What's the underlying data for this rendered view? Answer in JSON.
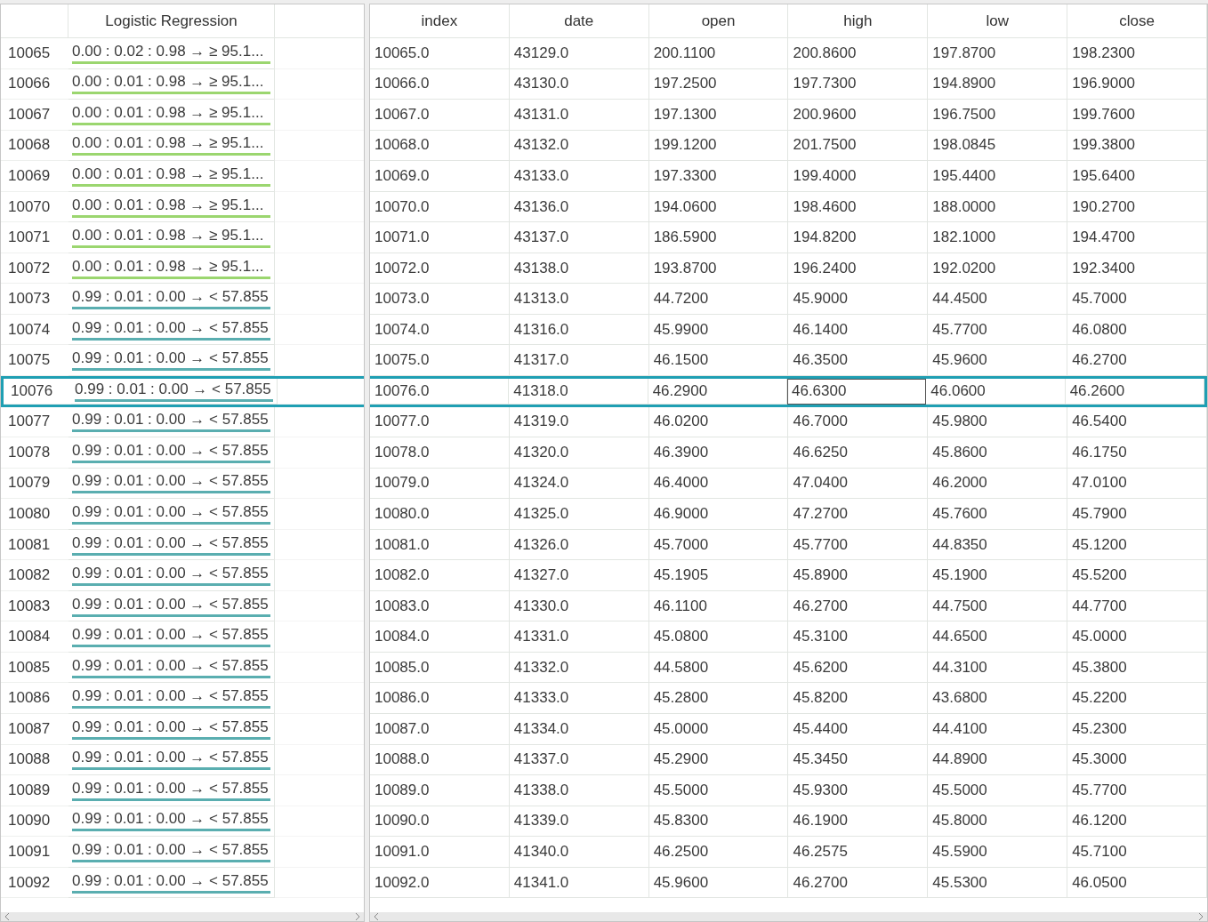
{
  "prediction_column": "Logistic Regression",
  "columns": [
    "index",
    "date",
    "open",
    "high",
    "low",
    "close"
  ],
  "rows": [
    {
      "id": "10065",
      "prediction": "0.00 : 0.02 : 0.98 → ≥ 95.1...",
      "color": "#9bd66f",
      "selected": false,
      "cells": [
        {
          "v": "10065.0",
          "focused": false
        },
        {
          "v": "43129.0",
          "focused": false
        },
        {
          "v": "200.1100",
          "focused": false
        },
        {
          "v": "200.8600",
          "focused": false
        },
        {
          "v": "197.8700",
          "focused": false
        },
        {
          "v": "198.2300",
          "focused": false
        }
      ]
    },
    {
      "id": "10066",
      "prediction": "0.00 : 0.01 : 0.98 → ≥ 95.1...",
      "color": "#9bd66f",
      "selected": false,
      "cells": [
        {
          "v": "10066.0",
          "focused": false
        },
        {
          "v": "43130.0",
          "focused": false
        },
        {
          "v": "197.2500",
          "focused": false
        },
        {
          "v": "197.7300",
          "focused": false
        },
        {
          "v": "194.8900",
          "focused": false
        },
        {
          "v": "196.9000",
          "focused": false
        }
      ]
    },
    {
      "id": "10067",
      "prediction": "0.00 : 0.01 : 0.98 → ≥ 95.1...",
      "color": "#9bd66f",
      "selected": false,
      "cells": [
        {
          "v": "10067.0",
          "focused": false
        },
        {
          "v": "43131.0",
          "focused": false
        },
        {
          "v": "197.1300",
          "focused": false
        },
        {
          "v": "200.9600",
          "focused": false
        },
        {
          "v": "196.7500",
          "focused": false
        },
        {
          "v": "199.7600",
          "focused": false
        }
      ]
    },
    {
      "id": "10068",
      "prediction": "0.00 : 0.01 : 0.98 → ≥ 95.1...",
      "color": "#9bd66f",
      "selected": false,
      "cells": [
        {
          "v": "10068.0",
          "focused": false
        },
        {
          "v": "43132.0",
          "focused": false
        },
        {
          "v": "199.1200",
          "focused": false
        },
        {
          "v": "201.7500",
          "focused": false
        },
        {
          "v": "198.0845",
          "focused": false
        },
        {
          "v": "199.3800",
          "focused": false
        }
      ]
    },
    {
      "id": "10069",
      "prediction": "0.00 : 0.01 : 0.98 → ≥ 95.1...",
      "color": "#9bd66f",
      "selected": false,
      "cells": [
        {
          "v": "10069.0",
          "focused": false
        },
        {
          "v": "43133.0",
          "focused": false
        },
        {
          "v": "197.3300",
          "focused": false
        },
        {
          "v": "199.4000",
          "focused": false
        },
        {
          "v": "195.4400",
          "focused": false
        },
        {
          "v": "195.6400",
          "focused": false
        }
      ]
    },
    {
      "id": "10070",
      "prediction": "0.00 : 0.01 : 0.98 → ≥ 95.1...",
      "color": "#9bd66f",
      "selected": false,
      "cells": [
        {
          "v": "10070.0",
          "focused": false
        },
        {
          "v": "43136.0",
          "focused": false
        },
        {
          "v": "194.0600",
          "focused": false
        },
        {
          "v": "198.4600",
          "focused": false
        },
        {
          "v": "188.0000",
          "focused": false
        },
        {
          "v": "190.2700",
          "focused": false
        }
      ]
    },
    {
      "id": "10071",
      "prediction": "0.00 : 0.01 : 0.98 → ≥ 95.1...",
      "color": "#9bd66f",
      "selected": false,
      "cells": [
        {
          "v": "10071.0",
          "focused": false
        },
        {
          "v": "43137.0",
          "focused": false
        },
        {
          "v": "186.5900",
          "focused": false
        },
        {
          "v": "194.8200",
          "focused": false
        },
        {
          "v": "182.1000",
          "focused": false
        },
        {
          "v": "194.4700",
          "focused": false
        }
      ]
    },
    {
      "id": "10072",
      "prediction": "0.00 : 0.01 : 0.98 → ≥ 95.1...",
      "color": "#9bd66f",
      "selected": false,
      "cells": [
        {
          "v": "10072.0",
          "focused": false
        },
        {
          "v": "43138.0",
          "focused": false
        },
        {
          "v": "193.8700",
          "focused": false
        },
        {
          "v": "196.2400",
          "focused": false
        },
        {
          "v": "192.0200",
          "focused": false
        },
        {
          "v": "192.3400",
          "focused": false
        }
      ]
    },
    {
      "id": "10073",
      "prediction": "0.99 : 0.01 : 0.00 → < 57.855",
      "color": "#5aaeb0",
      "selected": false,
      "cells": [
        {
          "v": "10073.0",
          "focused": false
        },
        {
          "v": "41313.0",
          "focused": false
        },
        {
          "v": "44.7200",
          "focused": false
        },
        {
          "v": "45.9000",
          "focused": false
        },
        {
          "v": "44.4500",
          "focused": false
        },
        {
          "v": "45.7000",
          "focused": false
        }
      ]
    },
    {
      "id": "10074",
      "prediction": "0.99 : 0.01 : 0.00 → < 57.855",
      "color": "#5aaeb0",
      "selected": false,
      "cells": [
        {
          "v": "10074.0",
          "focused": false
        },
        {
          "v": "41316.0",
          "focused": false
        },
        {
          "v": "45.9900",
          "focused": false
        },
        {
          "v": "46.1400",
          "focused": false
        },
        {
          "v": "45.7700",
          "focused": false
        },
        {
          "v": "46.0800",
          "focused": false
        }
      ]
    },
    {
      "id": "10075",
      "prediction": "0.99 : 0.01 : 0.00 → < 57.855",
      "color": "#5aaeb0",
      "selected": false,
      "cells": [
        {
          "v": "10075.0",
          "focused": false
        },
        {
          "v": "41317.0",
          "focused": false
        },
        {
          "v": "46.1500",
          "focused": false
        },
        {
          "v": "46.3500",
          "focused": false
        },
        {
          "v": "45.9600",
          "focused": false
        },
        {
          "v": "46.2700",
          "focused": false
        }
      ]
    },
    {
      "id": "10076",
      "prediction": "0.99 : 0.01 : 0.00 → < 57.855",
      "color": "#5aaeb0",
      "selected": true,
      "cells": [
        {
          "v": "10076.0",
          "focused": false
        },
        {
          "v": "41318.0",
          "focused": false
        },
        {
          "v": "46.2900",
          "focused": false
        },
        {
          "v": "46.6300",
          "focused": true
        },
        {
          "v": "46.0600",
          "focused": false
        },
        {
          "v": "46.2600",
          "focused": false
        }
      ]
    },
    {
      "id": "10077",
      "prediction": "0.99 : 0.01 : 0.00 → < 57.855",
      "color": "#5aaeb0",
      "selected": false,
      "cells": [
        {
          "v": "10077.0",
          "focused": false
        },
        {
          "v": "41319.0",
          "focused": false
        },
        {
          "v": "46.0200",
          "focused": false
        },
        {
          "v": "46.7000",
          "focused": false
        },
        {
          "v": "45.9800",
          "focused": false
        },
        {
          "v": "46.5400",
          "focused": false
        }
      ]
    },
    {
      "id": "10078",
      "prediction": "0.99 : 0.01 : 0.00 → < 57.855",
      "color": "#5aaeb0",
      "selected": false,
      "cells": [
        {
          "v": "10078.0",
          "focused": false
        },
        {
          "v": "41320.0",
          "focused": false
        },
        {
          "v": "46.3900",
          "focused": false
        },
        {
          "v": "46.6250",
          "focused": false
        },
        {
          "v": "45.8600",
          "focused": false
        },
        {
          "v": "46.1750",
          "focused": false
        }
      ]
    },
    {
      "id": "10079",
      "prediction": "0.99 : 0.01 : 0.00 → < 57.855",
      "color": "#5aaeb0",
      "selected": false,
      "cells": [
        {
          "v": "10079.0",
          "focused": false
        },
        {
          "v": "41324.0",
          "focused": false
        },
        {
          "v": "46.4000",
          "focused": false
        },
        {
          "v": "47.0400",
          "focused": false
        },
        {
          "v": "46.2000",
          "focused": false
        },
        {
          "v": "47.0100",
          "focused": false
        }
      ]
    },
    {
      "id": "10080",
      "prediction": "0.99 : 0.01 : 0.00 → < 57.855",
      "color": "#5aaeb0",
      "selected": false,
      "cells": [
        {
          "v": "10080.0",
          "focused": false
        },
        {
          "v": "41325.0",
          "focused": false
        },
        {
          "v": "46.9000",
          "focused": false
        },
        {
          "v": "47.2700",
          "focused": false
        },
        {
          "v": "45.7600",
          "focused": false
        },
        {
          "v": "45.7900",
          "focused": false
        }
      ]
    },
    {
      "id": "10081",
      "prediction": "0.99 : 0.01 : 0.00 → < 57.855",
      "color": "#5aaeb0",
      "selected": false,
      "cells": [
        {
          "v": "10081.0",
          "focused": false
        },
        {
          "v": "41326.0",
          "focused": false
        },
        {
          "v": "45.7000",
          "focused": false
        },
        {
          "v": "45.7700",
          "focused": false
        },
        {
          "v": "44.8350",
          "focused": false
        },
        {
          "v": "45.1200",
          "focused": false
        }
      ]
    },
    {
      "id": "10082",
      "prediction": "0.99 : 0.01 : 0.00 → < 57.855",
      "color": "#5aaeb0",
      "selected": false,
      "cells": [
        {
          "v": "10082.0",
          "focused": false
        },
        {
          "v": "41327.0",
          "focused": false
        },
        {
          "v": "45.1905",
          "focused": false
        },
        {
          "v": "45.8900",
          "focused": false
        },
        {
          "v": "45.1900",
          "focused": false
        },
        {
          "v": "45.5200",
          "focused": false
        }
      ]
    },
    {
      "id": "10083",
      "prediction": "0.99 : 0.01 : 0.00 → < 57.855",
      "color": "#5aaeb0",
      "selected": false,
      "cells": [
        {
          "v": "10083.0",
          "focused": false
        },
        {
          "v": "41330.0",
          "focused": false
        },
        {
          "v": "46.1100",
          "focused": false
        },
        {
          "v": "46.2700",
          "focused": false
        },
        {
          "v": "44.7500",
          "focused": false
        },
        {
          "v": "44.7700",
          "focused": false
        }
      ]
    },
    {
      "id": "10084",
      "prediction": "0.99 : 0.01 : 0.00 → < 57.855",
      "color": "#5aaeb0",
      "selected": false,
      "cells": [
        {
          "v": "10084.0",
          "focused": false
        },
        {
          "v": "41331.0",
          "focused": false
        },
        {
          "v": "45.0800",
          "focused": false
        },
        {
          "v": "45.3100",
          "focused": false
        },
        {
          "v": "44.6500",
          "focused": false
        },
        {
          "v": "45.0000",
          "focused": false
        }
      ]
    },
    {
      "id": "10085",
      "prediction": "0.99 : 0.01 : 0.00 → < 57.855",
      "color": "#5aaeb0",
      "selected": false,
      "cells": [
        {
          "v": "10085.0",
          "focused": false
        },
        {
          "v": "41332.0",
          "focused": false
        },
        {
          "v": "44.5800",
          "focused": false
        },
        {
          "v": "45.6200",
          "focused": false
        },
        {
          "v": "44.3100",
          "focused": false
        },
        {
          "v": "45.3800",
          "focused": false
        }
      ]
    },
    {
      "id": "10086",
      "prediction": "0.99 : 0.01 : 0.00 → < 57.855",
      "color": "#5aaeb0",
      "selected": false,
      "cells": [
        {
          "v": "10086.0",
          "focused": false
        },
        {
          "v": "41333.0",
          "focused": false
        },
        {
          "v": "45.2800",
          "focused": false
        },
        {
          "v": "45.8200",
          "focused": false
        },
        {
          "v": "43.6800",
          "focused": false
        },
        {
          "v": "45.2200",
          "focused": false
        }
      ]
    },
    {
      "id": "10087",
      "prediction": "0.99 : 0.01 : 0.00 → < 57.855",
      "color": "#5aaeb0",
      "selected": false,
      "cells": [
        {
          "v": "10087.0",
          "focused": false
        },
        {
          "v": "41334.0",
          "focused": false
        },
        {
          "v": "45.0000",
          "focused": false
        },
        {
          "v": "45.4400",
          "focused": false
        },
        {
          "v": "44.4100",
          "focused": false
        },
        {
          "v": "45.2300",
          "focused": false
        }
      ]
    },
    {
      "id": "10088",
      "prediction": "0.99 : 0.01 : 0.00 → < 57.855",
      "color": "#5aaeb0",
      "selected": false,
      "cells": [
        {
          "v": "10088.0",
          "focused": false
        },
        {
          "v": "41337.0",
          "focused": false
        },
        {
          "v": "45.2900",
          "focused": false
        },
        {
          "v": "45.3450",
          "focused": false
        },
        {
          "v": "44.8900",
          "focused": false
        },
        {
          "v": "45.3000",
          "focused": false
        }
      ]
    },
    {
      "id": "10089",
      "prediction": "0.99 : 0.01 : 0.00 → < 57.855",
      "color": "#5aaeb0",
      "selected": false,
      "cells": [
        {
          "v": "10089.0",
          "focused": false
        },
        {
          "v": "41338.0",
          "focused": false
        },
        {
          "v": "45.5000",
          "focused": false
        },
        {
          "v": "45.9300",
          "focused": false
        },
        {
          "v": "45.5000",
          "focused": false
        },
        {
          "v": "45.7700",
          "focused": false
        }
      ]
    },
    {
      "id": "10090",
      "prediction": "0.99 : 0.01 : 0.00 → < 57.855",
      "color": "#5aaeb0",
      "selected": false,
      "cells": [
        {
          "v": "10090.0",
          "focused": false
        },
        {
          "v": "41339.0",
          "focused": false
        },
        {
          "v": "45.8300",
          "focused": false
        },
        {
          "v": "46.1900",
          "focused": false
        },
        {
          "v": "45.8000",
          "focused": false
        },
        {
          "v": "46.1200",
          "focused": false
        }
      ]
    },
    {
      "id": "10091",
      "prediction": "0.99 : 0.01 : 0.00 → < 57.855",
      "color": "#5aaeb0",
      "selected": false,
      "cells": [
        {
          "v": "10091.0",
          "focused": false
        },
        {
          "v": "41340.0",
          "focused": false
        },
        {
          "v": "46.2500",
          "focused": false
        },
        {
          "v": "46.2575",
          "focused": false
        },
        {
          "v": "45.5900",
          "focused": false
        },
        {
          "v": "45.7100",
          "focused": false
        }
      ]
    },
    {
      "id": "10092",
      "prediction": "0.99 : 0.01 : 0.00 → < 57.855",
      "color": "#5aaeb0",
      "selected": false,
      "cells": [
        {
          "v": "10092.0",
          "focused": false
        },
        {
          "v": "41341.0",
          "focused": false
        },
        {
          "v": "45.9600",
          "focused": false
        },
        {
          "v": "46.2700",
          "focused": false
        },
        {
          "v": "45.5300",
          "focused": false
        },
        {
          "v": "46.0500",
          "focused": false
        }
      ]
    }
  ]
}
